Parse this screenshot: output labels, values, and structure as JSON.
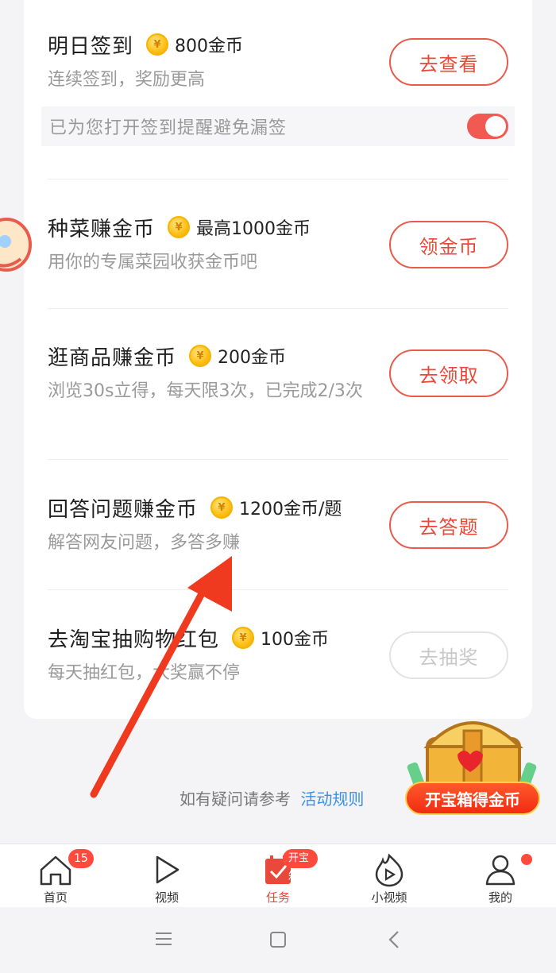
{
  "tasks": [
    {
      "title": "明日签到",
      "reward": "800金币",
      "desc": "连续签到，奖励更高",
      "button": "去查看"
    },
    {
      "title": "种菜赚金币",
      "reward": "最高1000金币",
      "desc": "用你的专属菜园收获金币吧",
      "button": "领金币"
    },
    {
      "title": "逛商品赚金币",
      "reward": "200金币",
      "desc": "浏览30s立得，每天限3次，已完成2/3次",
      "button": "去领取"
    },
    {
      "title": "回答问题赚金币",
      "reward": "1200金币/题",
      "desc": "解答网友问题，多答多赚",
      "button": "去答题"
    },
    {
      "title": "去淘宝抽购物红包",
      "reward": "100金币",
      "desc": "每天抽红包，大奖赢不停",
      "button": "去抽奖"
    }
  ],
  "reminder": {
    "text": "已为您打开签到提醒避免漏签",
    "enabled": true
  },
  "coin_symbol": "¥",
  "faq": {
    "text": "如有疑问请参考",
    "link": "活动规则"
  },
  "treasure": {
    "label": "开宝箱得金币"
  },
  "tabbar": [
    {
      "label": "首页",
      "icon": "home-icon",
      "badge": "15"
    },
    {
      "label": "视频",
      "icon": "play-icon"
    },
    {
      "label": "任务",
      "icon": "task-icon",
      "badge": "开宝箱",
      "active": true
    },
    {
      "label": "小视频",
      "icon": "flame-play-icon"
    },
    {
      "label": "我的",
      "icon": "profile-icon",
      "dot": true
    }
  ],
  "colors": {
    "accent": "#e8493a",
    "link": "#3b8ee8",
    "coin": "#ffc21a"
  }
}
